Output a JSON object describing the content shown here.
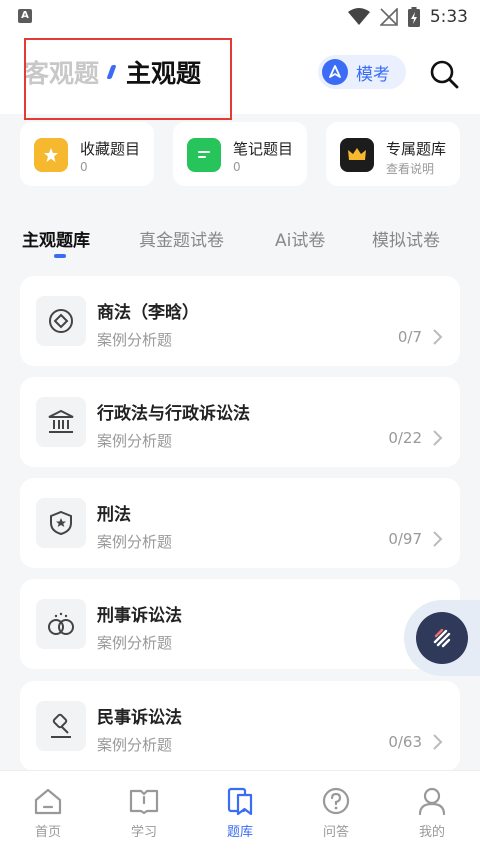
{
  "status_bar": {
    "time": "5:33",
    "app_icon": "A"
  },
  "header": {
    "tab_inactive": "客观题",
    "tab_active": "主观题",
    "mock_exam_label": "模考"
  },
  "quick_links": [
    {
      "title": "收藏题目",
      "sub": "0",
      "icon": "star-folder-icon",
      "color": "#f5b82e"
    },
    {
      "title": "笔记题目",
      "sub": "0",
      "icon": "note-icon",
      "color": "#27c35b"
    },
    {
      "title": "专属题库",
      "sub": "查看说明",
      "icon": "crown-icon",
      "color": "#1c1c1c"
    }
  ],
  "tabs": [
    {
      "label": "主观题库",
      "active": true
    },
    {
      "label": "真金题试卷",
      "active": false
    },
    {
      "label": "Ai试卷",
      "active": false
    },
    {
      "label": "模拟试卷",
      "active": false
    }
  ],
  "subjects": [
    {
      "title": "商法（李晗）",
      "sub": "案例分析题",
      "count": "0/7",
      "icon": "diamond-icon"
    },
    {
      "title": "行政法与行政诉讼法",
      "sub": "案例分析题",
      "count": "0/22",
      "icon": "institution-icon"
    },
    {
      "title": "刑法",
      "sub": "案例分析题",
      "count": "0/97",
      "icon": "shield-icon"
    },
    {
      "title": "刑事诉讼法",
      "sub": "案例分析题",
      "count": "0/",
      "icon": "handcuffs-icon"
    },
    {
      "title": "民事诉讼法",
      "sub": "案例分析题",
      "count": "0/63",
      "icon": "gavel-icon"
    }
  ],
  "bottom_nav": [
    {
      "label": "首页",
      "icon": "home-icon",
      "active": false
    },
    {
      "label": "学习",
      "icon": "book-icon",
      "active": false
    },
    {
      "label": "题库",
      "icon": "question-bank-icon",
      "active": true
    },
    {
      "label": "问答",
      "icon": "question-icon",
      "active": false
    },
    {
      "label": "我的",
      "icon": "user-icon",
      "active": false
    }
  ],
  "colors": {
    "accent": "#3b6cf6",
    "highlight_border": "#e53935"
  }
}
